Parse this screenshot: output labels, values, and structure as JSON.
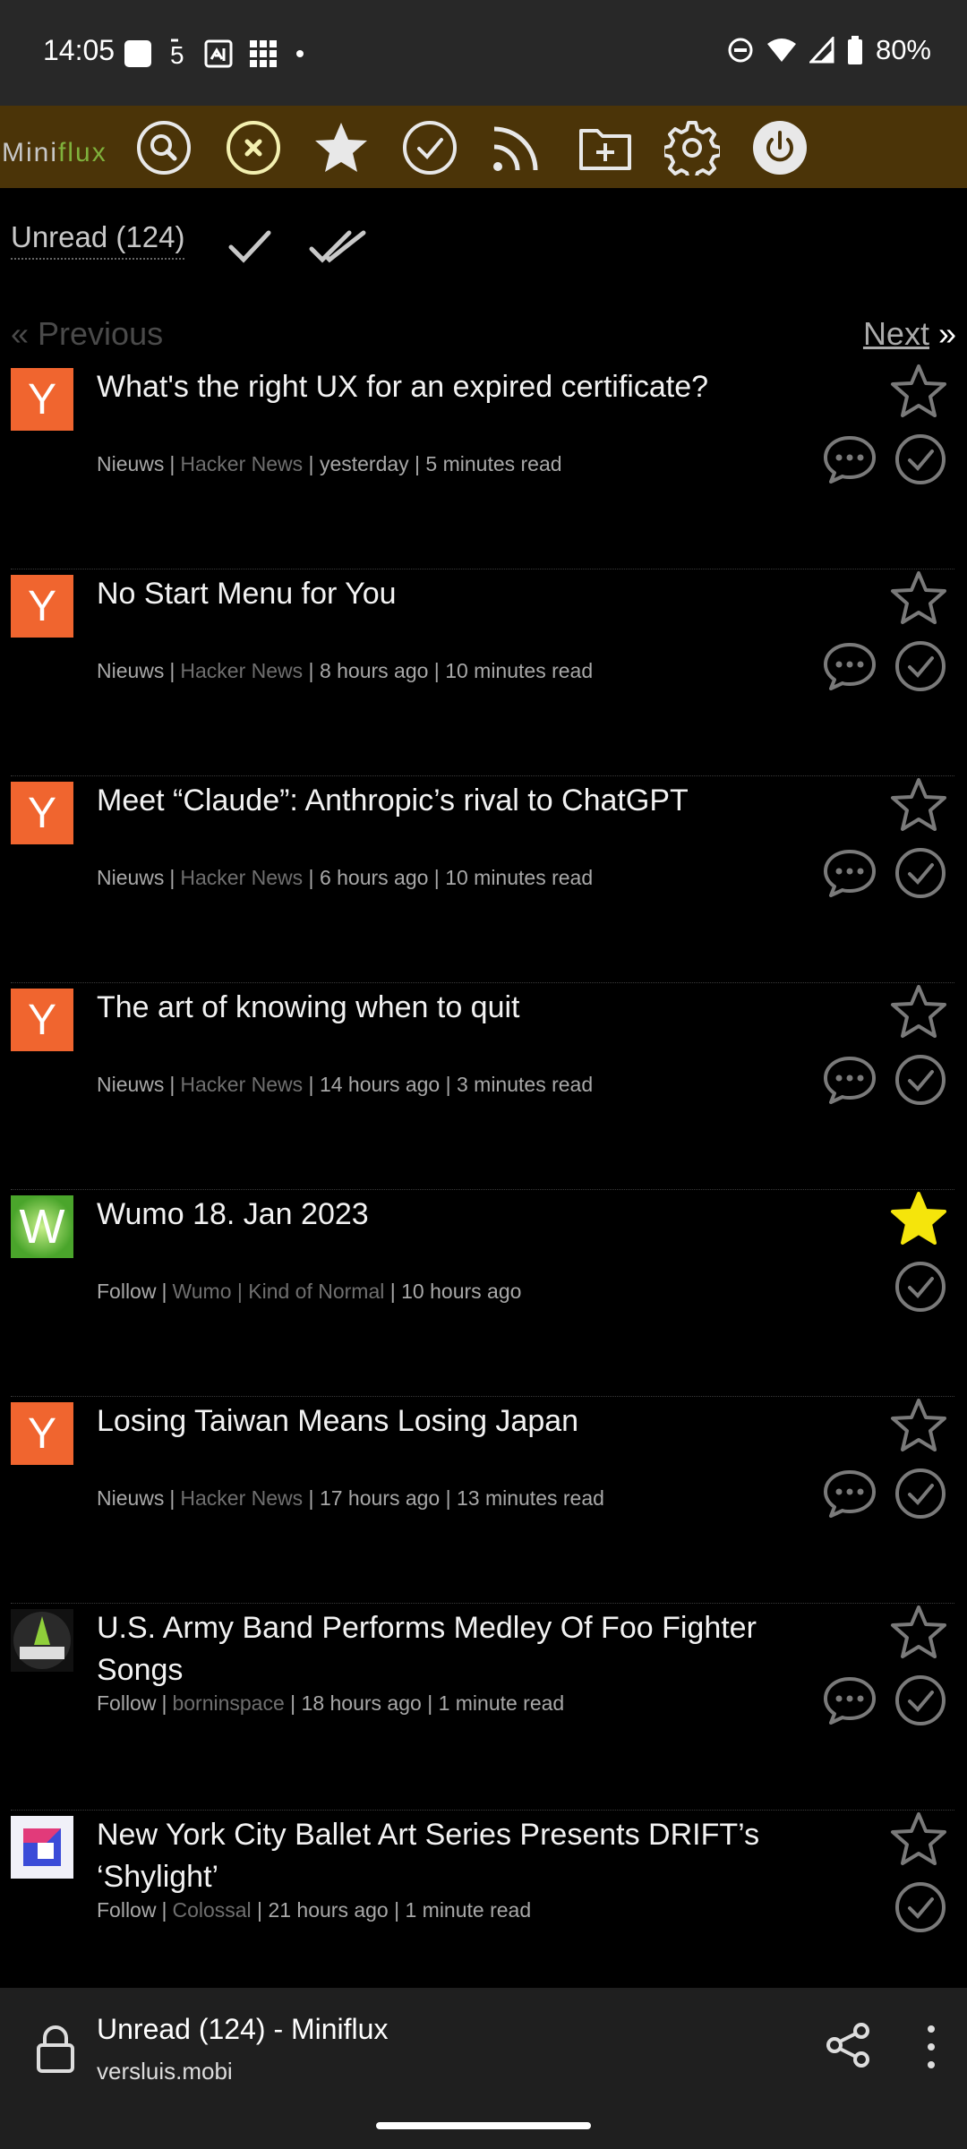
{
  "status_bar": {
    "time": "14:05",
    "battery": "80%",
    "icons": [
      "square-notification-icon",
      "network-speed-icon",
      "vpn-icon",
      "grid-icon",
      "dot-icon",
      "do-not-disturb-icon",
      "wifi-icon",
      "signal-icon",
      "battery-icon"
    ]
  },
  "nav": {
    "logo_prefix": "Mini",
    "logo_accent": "flux",
    "accent_color": "#7fb13c",
    "bar_color": "#4b3408",
    "icons": [
      "search-icon",
      "unread-icon",
      "starred-icon",
      "history-icon",
      "feeds-icon",
      "categories-icon",
      "settings-icon",
      "logout-icon"
    ]
  },
  "page": {
    "title": "Unread (124)",
    "prev_label": "« Previous",
    "next_label": "Next",
    "next_suffix": " »"
  },
  "items": [
    {
      "title": "What's the right UX for an expired certificate?",
      "category": "Nieuws",
      "feed": "Hacker News",
      "date": "yesterday",
      "reading_time": "5 minutes read",
      "favicon_text": "Y",
      "starred": false,
      "has_comments": true
    },
    {
      "title": "No Start Menu for You",
      "category": "Nieuws",
      "feed": "Hacker News",
      "date": "8 hours ago",
      "reading_time": "10 minutes read",
      "favicon_text": "Y",
      "starred": false,
      "has_comments": true
    },
    {
      "title": "Meet “Claude”: Anthropic’s rival to ChatGPT",
      "category": "Nieuws",
      "feed": "Hacker News",
      "date": "6 hours ago",
      "reading_time": "10 minutes read",
      "favicon_text": "Y",
      "starred": false,
      "has_comments": true
    },
    {
      "title": "The art of knowing when to quit",
      "category": "Nieuws",
      "feed": "Hacker News",
      "date": "14 hours ago",
      "reading_time": "3 minutes read",
      "favicon_text": "Y",
      "starred": false,
      "has_comments": true
    },
    {
      "title": "Wumo 18. Jan 2023",
      "category": "Follow",
      "feed": "Wumo | Kind of Normal",
      "date": "10 hours ago",
      "reading_time": "",
      "favicon_text": "W",
      "starred": true,
      "has_comments": false
    },
    {
      "title": "Losing Taiwan Means Losing Japan",
      "category": "Nieuws",
      "feed": "Hacker News",
      "date": "17 hours ago",
      "reading_time": "13 minutes read",
      "favicon_text": "Y",
      "starred": false,
      "has_comments": true
    },
    {
      "title": "U.S. Army Band Performs Medley Of Foo Fighter Songs",
      "category": "Follow",
      "feed": "borninspace",
      "date": "18 hours ago",
      "reading_time": "1 minute read",
      "favicon_text": "",
      "starred": false,
      "has_comments": true
    },
    {
      "title": "New York City Ballet Art Series Presents DRIFT’s ‘Shylight’",
      "category": "Follow",
      "feed": "Colossal",
      "date": "21 hours ago",
      "reading_time": "1 minute read",
      "favicon_text": "",
      "starred": false,
      "has_comments": false
    }
  ],
  "browser": {
    "tab_title": "Unread (124) - Miniflux",
    "domain": "versluis.mobi"
  }
}
